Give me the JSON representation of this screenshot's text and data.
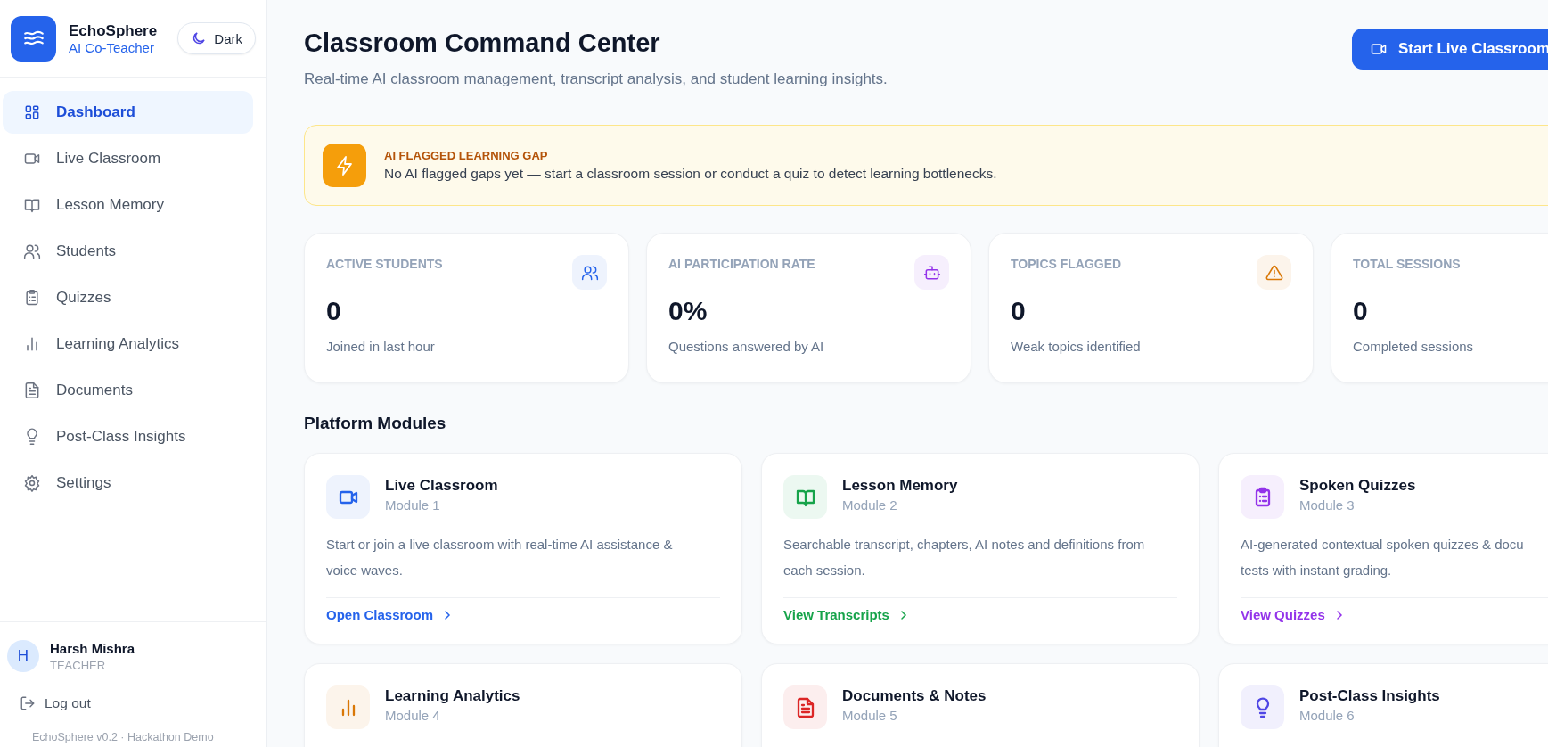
{
  "sidebar": {
    "brand": {
      "name": "EchoSphere",
      "tagline": "AI Co-Teacher"
    },
    "theme_button": {
      "label": "Dark"
    },
    "nav": [
      {
        "label": "Dashboard",
        "kind": "grid",
        "selected": true
      },
      {
        "label": "Live Classroom",
        "kind": "video",
        "selected": false
      },
      {
        "label": "Lesson Memory",
        "kind": "book",
        "selected": false
      },
      {
        "label": "Students",
        "kind": "users",
        "selected": false
      },
      {
        "label": "Quizzes",
        "kind": "clipboard",
        "selected": false
      },
      {
        "label": "Learning Analytics",
        "kind": "chart",
        "selected": false
      },
      {
        "label": "Documents",
        "kind": "file",
        "selected": false
      },
      {
        "label": "Post-Class Insights",
        "kind": "bulb",
        "selected": false
      },
      {
        "label": "Settings",
        "kind": "gear",
        "selected": false
      }
    ],
    "user": {
      "initial": "H",
      "name": "Harsh Mishra",
      "role": "TEACHER"
    },
    "logout": "Log out",
    "version": "EchoSphere v0.2 · Hackathon Demo"
  },
  "header": {
    "title": "Classroom Command Center",
    "subtitle": "Real-time AI classroom management, transcript analysis, and student learning insights.",
    "action": "Start Live Classroom"
  },
  "alert": {
    "title": "AI FLAGGED LEARNING GAP",
    "message": "No AI flagged gaps yet — start a classroom session or conduct a quiz to detect learning bottlenecks."
  },
  "stats": [
    {
      "label": "ACTIVE STUDENTS",
      "value": "0",
      "caption": "Joined in last hour",
      "kind": "users",
      "color": "#2563eb"
    },
    {
      "label": "AI PARTICIPATION RATE",
      "value": "0%",
      "caption": "Questions answered by AI",
      "kind": "bot",
      "color": "#9333ea"
    },
    {
      "label": "TOPICS FLAGGED",
      "value": "0",
      "caption": "Weak topics identified",
      "kind": "alert",
      "color": "#d97706"
    },
    {
      "label": "TOTAL SESSIONS",
      "value": "0",
      "caption": "Completed sessions"
    }
  ],
  "modules": {
    "heading": "Platform Modules",
    "cards": [
      {
        "title": "Live Classroom",
        "module": "Module 1",
        "kind": "video",
        "color": "#2563eb",
        "description": "Start or join a live classroom with real-time AI assistance &\nvoice waves.",
        "link": "Open Classroom"
      },
      {
        "title": "Lesson Memory",
        "module": "Module 2",
        "kind": "book",
        "color": "#16a34a",
        "description": "Searchable transcript, chapters, AI notes and definitions from\neach session.",
        "link": "View Transcripts"
      },
      {
        "title": "Spoken Quizzes",
        "module": "Module 3",
        "kind": "clipboard",
        "color": "#9333ea",
        "description": "AI-generated contextual spoken quizzes & docu\ntests with instant grading.",
        "link": "View Quizzes"
      },
      {
        "title": "Learning Analytics",
        "module": "Module 4",
        "kind": "chart",
        "color": "#d97706"
      },
      {
        "title": "Documents & Notes",
        "module": "Module 5",
        "kind": "file",
        "color": "#dc2626"
      },
      {
        "title": "Post-Class Insights",
        "module": "Module 6",
        "kind": "bulb",
        "color": "#4f46e5"
      }
    ]
  }
}
